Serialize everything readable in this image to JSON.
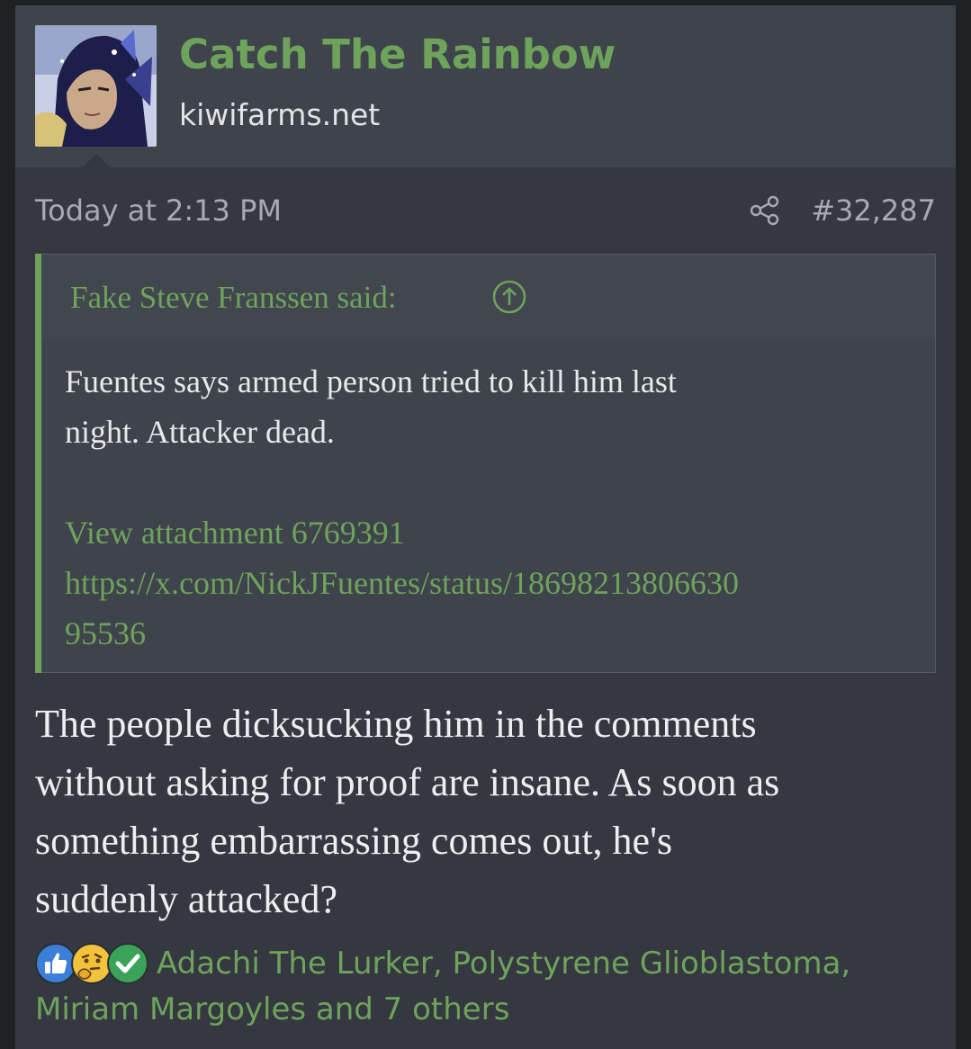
{
  "header": {
    "username": "Catch The Rainbow",
    "site": "kiwifarms.net"
  },
  "post": {
    "date": "Today at 2:13 PM",
    "number": "#32,287"
  },
  "quote": {
    "author_label": "Fake Steve Franssen said:",
    "body_lines": [
      "Fuentes says armed person tried to kill him last",
      "night. Attacker dead."
    ],
    "attachment_link": "View attachment 6769391",
    "url_lines": [
      "https://x.com/NickJFuentes/status/18698213806630",
      "95536"
    ]
  },
  "message": {
    "lines": [
      "The people dicksucking him in the comments",
      "without asking for proof are insane. As soon as",
      "something embarrassing comes out, he's",
      "suddenly attacked?"
    ]
  },
  "reactions": {
    "icons": [
      "thumbs-up-icon",
      "thinking-face-icon",
      "checkmark-icon"
    ],
    "line1": "Adachi The Lurker, Polystyrene Glioblastoma,",
    "line2": "Miriam Margoyles and 7 others"
  },
  "colors": {
    "accent_green": "#6ea35b",
    "background": "#353841",
    "header_bg": "#3f434c",
    "muted_text": "#a7aab0"
  }
}
